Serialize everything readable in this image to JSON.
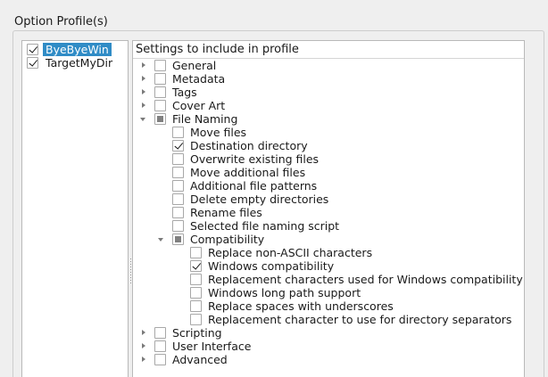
{
  "group": {
    "title": "Option Profile(s)"
  },
  "profiles": [
    {
      "label": "ByeByeWin",
      "checked": true,
      "selected": true
    },
    {
      "label": "TargetMyDir",
      "checked": true,
      "selected": false
    }
  ],
  "tree": {
    "header": "Settings to include in profile",
    "rows": [
      {
        "label": "General",
        "level": 0,
        "expander": "closed",
        "state": "unchecked"
      },
      {
        "label": "Metadata",
        "level": 0,
        "expander": "closed",
        "state": "unchecked"
      },
      {
        "label": "Tags",
        "level": 0,
        "expander": "closed",
        "state": "unchecked"
      },
      {
        "label": "Cover Art",
        "level": 0,
        "expander": "closed",
        "state": "unchecked"
      },
      {
        "label": "File Naming",
        "level": 0,
        "expander": "open",
        "state": "partial"
      },
      {
        "label": "Move files",
        "level": 1,
        "expander": "none",
        "state": "unchecked"
      },
      {
        "label": "Destination directory",
        "level": 1,
        "expander": "none",
        "state": "checked"
      },
      {
        "label": "Overwrite existing files",
        "level": 1,
        "expander": "none",
        "state": "unchecked"
      },
      {
        "label": "Move additional files",
        "level": 1,
        "expander": "none",
        "state": "unchecked"
      },
      {
        "label": "Additional file patterns",
        "level": 1,
        "expander": "none",
        "state": "unchecked"
      },
      {
        "label": "Delete empty directories",
        "level": 1,
        "expander": "none",
        "state": "unchecked"
      },
      {
        "label": "Rename files",
        "level": 1,
        "expander": "none",
        "state": "unchecked"
      },
      {
        "label": "Selected file naming script",
        "level": 1,
        "expander": "none",
        "state": "unchecked"
      },
      {
        "label": "Compatibility",
        "level": 1,
        "expander": "open",
        "state": "partial"
      },
      {
        "label": "Replace non-ASCII characters",
        "level": 2,
        "expander": "none",
        "state": "unchecked"
      },
      {
        "label": "Windows compatibility",
        "level": 2,
        "expander": "none",
        "state": "checked"
      },
      {
        "label": "Replacement characters used for Windows compatibility",
        "level": 2,
        "expander": "none",
        "state": "unchecked"
      },
      {
        "label": "Windows long path support",
        "level": 2,
        "expander": "none",
        "state": "unchecked"
      },
      {
        "label": "Replace spaces with underscores",
        "level": 2,
        "expander": "none",
        "state": "unchecked"
      },
      {
        "label": "Replacement character to use for directory separators",
        "level": 2,
        "expander": "none",
        "state": "unchecked"
      },
      {
        "label": "Scripting",
        "level": 0,
        "expander": "closed",
        "state": "unchecked"
      },
      {
        "label": "User Interface",
        "level": 0,
        "expander": "closed",
        "state": "unchecked"
      },
      {
        "label": "Advanced",
        "level": 0,
        "expander": "closed",
        "state": "unchecked"
      }
    ]
  },
  "colors": {
    "selection": "#308cc6",
    "background": "#efefef",
    "list_background": "#ffffff"
  }
}
